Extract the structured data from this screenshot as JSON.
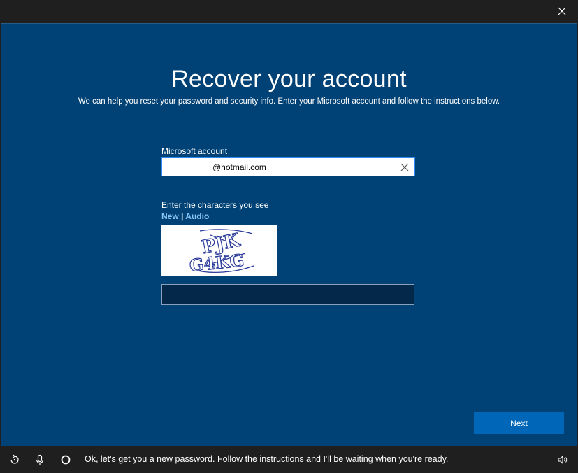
{
  "window": {
    "close_label": "Close"
  },
  "page": {
    "title": "Recover your account",
    "subtitle": "We can help you reset your password and security info. Enter your Microsoft account and follow the instructions below."
  },
  "account": {
    "label": "Microsoft account",
    "value": "@hotmail.com"
  },
  "captcha": {
    "label": "Enter the characters you see",
    "new_link": "New",
    "separator": "|",
    "audio_link": "Audio",
    "chars": "PJK G4KG",
    "input_value": ""
  },
  "actions": {
    "next_label": "Next"
  },
  "cortana": {
    "message": "Ok, let's get you a new password. Follow the instructions and I'll be waiting when you're ready."
  },
  "icons": [
    "close-icon",
    "clear-icon",
    "ease-of-access-icon",
    "microphone-icon",
    "cortana-circle-icon",
    "volume-icon"
  ],
  "colors": {
    "background": "#004275",
    "accent": "#0067b8",
    "link": "#8cc6f5"
  }
}
